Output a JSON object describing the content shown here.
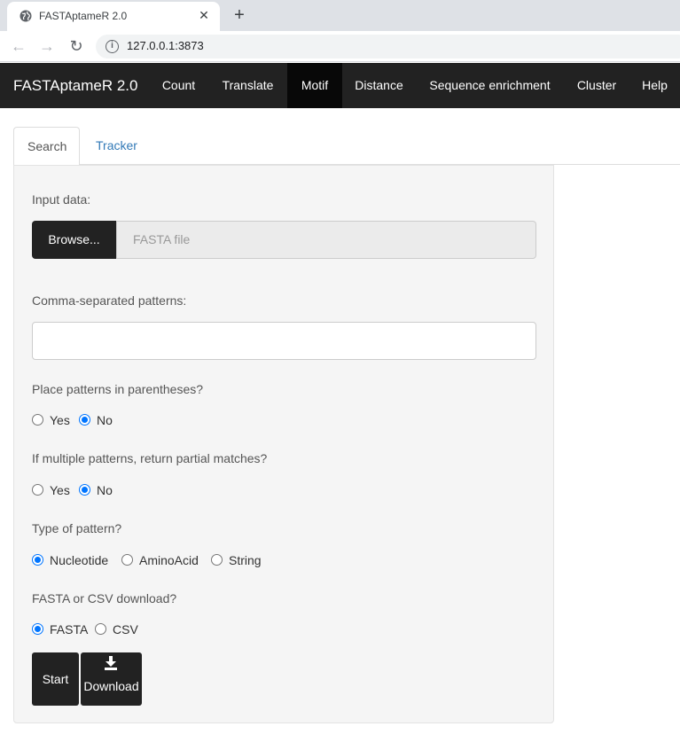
{
  "browser": {
    "tab_title": "FASTAptameR 2.0",
    "url": "127.0.0.1:3873"
  },
  "navbar": {
    "brand": "FASTAptameR 2.0",
    "items": [
      {
        "label": "Count",
        "active": false
      },
      {
        "label": "Translate",
        "active": false
      },
      {
        "label": "Motif",
        "active": true
      },
      {
        "label": "Distance",
        "active": false
      },
      {
        "label": "Sequence enrichment",
        "active": false
      },
      {
        "label": "Cluster",
        "active": false
      },
      {
        "label": "Help",
        "active": false
      }
    ]
  },
  "tabs": [
    {
      "label": "Search",
      "active": true
    },
    {
      "label": "Tracker",
      "active": false
    }
  ],
  "form": {
    "input_label": "Input data:",
    "browse_label": "Browse...",
    "file_placeholder": "FASTA file",
    "patterns_label": "Comma-separated patterns:",
    "patterns_value": "",
    "parentheses_label": "Place patterns in parentheses?",
    "parentheses_options": [
      "Yes",
      "No"
    ],
    "parentheses_selected": "No",
    "partial_label": "If multiple patterns, return partial matches?",
    "partial_options": [
      "Yes",
      "No"
    ],
    "partial_selected": "No",
    "type_label": "Type of pattern?",
    "type_options": [
      "Nucleotide",
      "AminoAcid",
      "String"
    ],
    "type_selected": "Nucleotide",
    "download_type_label": "FASTA or CSV download?",
    "download_type_options": [
      "FASTA",
      "CSV"
    ],
    "download_type_selected": "FASTA",
    "start_label": "Start",
    "download_label": "Download"
  }
}
